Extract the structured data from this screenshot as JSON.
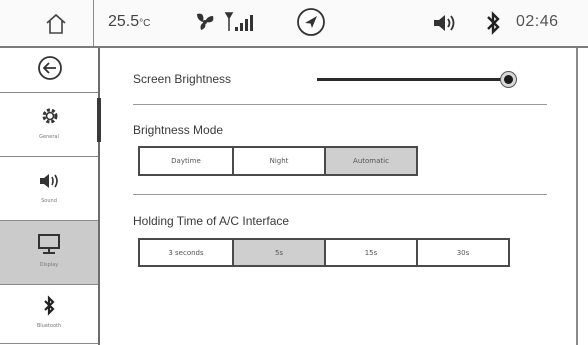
{
  "status_bar": {
    "temperature": "25.5",
    "temperature_unit": "°C",
    "time": "02:46",
    "icons": [
      "home-icon",
      "fan-icon",
      "signal-icon",
      "navigation-icon",
      "volume-icon",
      "bluetooth-icon"
    ]
  },
  "sidebar": {
    "items": [
      {
        "name": "back",
        "icon": "back-arrow-icon",
        "label": ""
      },
      {
        "name": "general",
        "icon": "gear-icon",
        "label": "General"
      },
      {
        "name": "sound",
        "icon": "speaker-icon",
        "label": "Sound"
      },
      {
        "name": "display",
        "icon": "monitor-icon",
        "label": "Display",
        "selected": true
      },
      {
        "name": "bluetooth",
        "icon": "bluetooth-icon",
        "label": "Bluetooth"
      }
    ]
  },
  "main": {
    "brightness_label": "Screen Brightness",
    "brightness_level": 1.0,
    "mode_label": "Brightness Mode",
    "mode_options": [
      "Daytime",
      "Night",
      "Automatic"
    ],
    "mode_selected": "Automatic",
    "holding_label": "Holding Time of A/C Interface",
    "holding_options": [
      "3 seconds",
      "5s",
      "15s",
      "30s"
    ],
    "holding_selected": "5s"
  },
  "colors": {
    "selected_bg": "#cfcfcf",
    "border": "#4a4a4a",
    "text": "#3a3a3a"
  }
}
